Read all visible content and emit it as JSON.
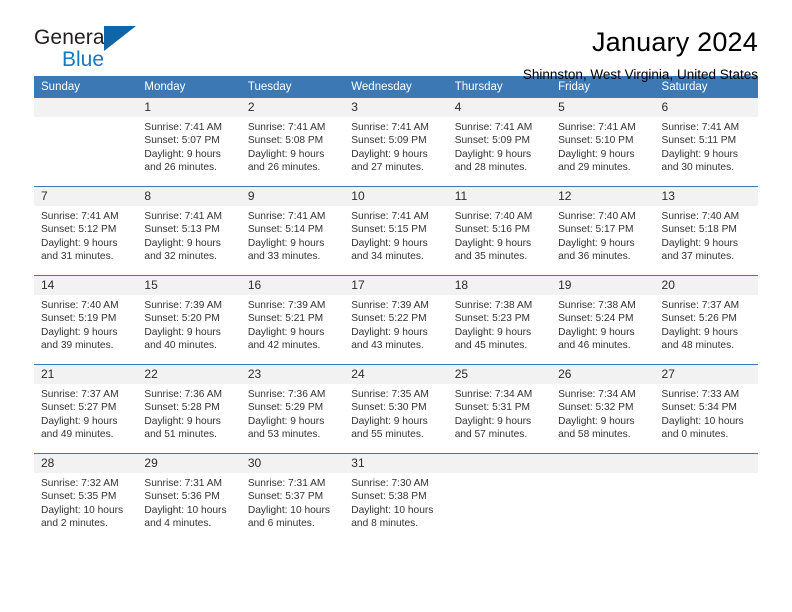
{
  "brand": {
    "name_top": "General",
    "name_bottom": "Blue",
    "triangle_color": "#1064a8",
    "blue_text_color": "#1878be"
  },
  "header": {
    "month_title": "January 2024",
    "location": "Shinnston, West Virginia, United States"
  },
  "colors": {
    "header_bar": "#3c78b4",
    "daynum_band": "#f2f2f2",
    "text": "#333333"
  },
  "weekday_headers": [
    "Sunday",
    "Monday",
    "Tuesday",
    "Wednesday",
    "Thursday",
    "Friday",
    "Saturday"
  ],
  "labels": {
    "sunrise_prefix": "Sunrise:",
    "sunset_prefix": "Sunset:",
    "daylight_prefix": "Daylight:"
  },
  "weeks": [
    [
      {
        "blank": true
      },
      {
        "day": "1",
        "sunrise": "Sunrise: 7:41 AM",
        "sunset": "Sunset: 5:07 PM",
        "daylight_line1": "Daylight: 9 hours",
        "daylight_line2": "and 26 minutes."
      },
      {
        "day": "2",
        "sunrise": "Sunrise: 7:41 AM",
        "sunset": "Sunset: 5:08 PM",
        "daylight_line1": "Daylight: 9 hours",
        "daylight_line2": "and 26 minutes."
      },
      {
        "day": "3",
        "sunrise": "Sunrise: 7:41 AM",
        "sunset": "Sunset: 5:09 PM",
        "daylight_line1": "Daylight: 9 hours",
        "daylight_line2": "and 27 minutes."
      },
      {
        "day": "4",
        "sunrise": "Sunrise: 7:41 AM",
        "sunset": "Sunset: 5:09 PM",
        "daylight_line1": "Daylight: 9 hours",
        "daylight_line2": "and 28 minutes."
      },
      {
        "day": "5",
        "sunrise": "Sunrise: 7:41 AM",
        "sunset": "Sunset: 5:10 PM",
        "daylight_line1": "Daylight: 9 hours",
        "daylight_line2": "and 29 minutes."
      },
      {
        "day": "6",
        "sunrise": "Sunrise: 7:41 AM",
        "sunset": "Sunset: 5:11 PM",
        "daylight_line1": "Daylight: 9 hours",
        "daylight_line2": "and 30 minutes."
      }
    ],
    [
      {
        "day": "7",
        "sunrise": "Sunrise: 7:41 AM",
        "sunset": "Sunset: 5:12 PM",
        "daylight_line1": "Daylight: 9 hours",
        "daylight_line2": "and 31 minutes."
      },
      {
        "day": "8",
        "sunrise": "Sunrise: 7:41 AM",
        "sunset": "Sunset: 5:13 PM",
        "daylight_line1": "Daylight: 9 hours",
        "daylight_line2": "and 32 minutes."
      },
      {
        "day": "9",
        "sunrise": "Sunrise: 7:41 AM",
        "sunset": "Sunset: 5:14 PM",
        "daylight_line1": "Daylight: 9 hours",
        "daylight_line2": "and 33 minutes."
      },
      {
        "day": "10",
        "sunrise": "Sunrise: 7:41 AM",
        "sunset": "Sunset: 5:15 PM",
        "daylight_line1": "Daylight: 9 hours",
        "daylight_line2": "and 34 minutes."
      },
      {
        "day": "11",
        "sunrise": "Sunrise: 7:40 AM",
        "sunset": "Sunset: 5:16 PM",
        "daylight_line1": "Daylight: 9 hours",
        "daylight_line2": "and 35 minutes."
      },
      {
        "day": "12",
        "sunrise": "Sunrise: 7:40 AM",
        "sunset": "Sunset: 5:17 PM",
        "daylight_line1": "Daylight: 9 hours",
        "daylight_line2": "and 36 minutes."
      },
      {
        "day": "13",
        "sunrise": "Sunrise: 7:40 AM",
        "sunset": "Sunset: 5:18 PM",
        "daylight_line1": "Daylight: 9 hours",
        "daylight_line2": "and 37 minutes."
      }
    ],
    [
      {
        "day": "14",
        "sunrise": "Sunrise: 7:40 AM",
        "sunset": "Sunset: 5:19 PM",
        "daylight_line1": "Daylight: 9 hours",
        "daylight_line2": "and 39 minutes."
      },
      {
        "day": "15",
        "sunrise": "Sunrise: 7:39 AM",
        "sunset": "Sunset: 5:20 PM",
        "daylight_line1": "Daylight: 9 hours",
        "daylight_line2": "and 40 minutes."
      },
      {
        "day": "16",
        "sunrise": "Sunrise: 7:39 AM",
        "sunset": "Sunset: 5:21 PM",
        "daylight_line1": "Daylight: 9 hours",
        "daylight_line2": "and 42 minutes."
      },
      {
        "day": "17",
        "sunrise": "Sunrise: 7:39 AM",
        "sunset": "Sunset: 5:22 PM",
        "daylight_line1": "Daylight: 9 hours",
        "daylight_line2": "and 43 minutes."
      },
      {
        "day": "18",
        "sunrise": "Sunrise: 7:38 AM",
        "sunset": "Sunset: 5:23 PM",
        "daylight_line1": "Daylight: 9 hours",
        "daylight_line2": "and 45 minutes."
      },
      {
        "day": "19",
        "sunrise": "Sunrise: 7:38 AM",
        "sunset": "Sunset: 5:24 PM",
        "daylight_line1": "Daylight: 9 hours",
        "daylight_line2": "and 46 minutes."
      },
      {
        "day": "20",
        "sunrise": "Sunrise: 7:37 AM",
        "sunset": "Sunset: 5:26 PM",
        "daylight_line1": "Daylight: 9 hours",
        "daylight_line2": "and 48 minutes."
      }
    ],
    [
      {
        "day": "21",
        "sunrise": "Sunrise: 7:37 AM",
        "sunset": "Sunset: 5:27 PM",
        "daylight_line1": "Daylight: 9 hours",
        "daylight_line2": "and 49 minutes."
      },
      {
        "day": "22",
        "sunrise": "Sunrise: 7:36 AM",
        "sunset": "Sunset: 5:28 PM",
        "daylight_line1": "Daylight: 9 hours",
        "daylight_line2": "and 51 minutes."
      },
      {
        "day": "23",
        "sunrise": "Sunrise: 7:36 AM",
        "sunset": "Sunset: 5:29 PM",
        "daylight_line1": "Daylight: 9 hours",
        "daylight_line2": "and 53 minutes."
      },
      {
        "day": "24",
        "sunrise": "Sunrise: 7:35 AM",
        "sunset": "Sunset: 5:30 PM",
        "daylight_line1": "Daylight: 9 hours",
        "daylight_line2": "and 55 minutes."
      },
      {
        "day": "25",
        "sunrise": "Sunrise: 7:34 AM",
        "sunset": "Sunset: 5:31 PM",
        "daylight_line1": "Daylight: 9 hours",
        "daylight_line2": "and 57 minutes."
      },
      {
        "day": "26",
        "sunrise": "Sunrise: 7:34 AM",
        "sunset": "Sunset: 5:32 PM",
        "daylight_line1": "Daylight: 9 hours",
        "daylight_line2": "and 58 minutes."
      },
      {
        "day": "27",
        "sunrise": "Sunrise: 7:33 AM",
        "sunset": "Sunset: 5:34 PM",
        "daylight_line1": "Daylight: 10 hours",
        "daylight_line2": "and 0 minutes."
      }
    ],
    [
      {
        "day": "28",
        "sunrise": "Sunrise: 7:32 AM",
        "sunset": "Sunset: 5:35 PM",
        "daylight_line1": "Daylight: 10 hours",
        "daylight_line2": "and 2 minutes."
      },
      {
        "day": "29",
        "sunrise": "Sunrise: 7:31 AM",
        "sunset": "Sunset: 5:36 PM",
        "daylight_line1": "Daylight: 10 hours",
        "daylight_line2": "and 4 minutes."
      },
      {
        "day": "30",
        "sunrise": "Sunrise: 7:31 AM",
        "sunset": "Sunset: 5:37 PM",
        "daylight_line1": "Daylight: 10 hours",
        "daylight_line2": "and 6 minutes."
      },
      {
        "day": "31",
        "sunrise": "Sunrise: 7:30 AM",
        "sunset": "Sunset: 5:38 PM",
        "daylight_line1": "Daylight: 10 hours",
        "daylight_line2": "and 8 minutes."
      },
      {
        "blank": true
      },
      {
        "blank": true
      },
      {
        "blank": true
      }
    ]
  ]
}
